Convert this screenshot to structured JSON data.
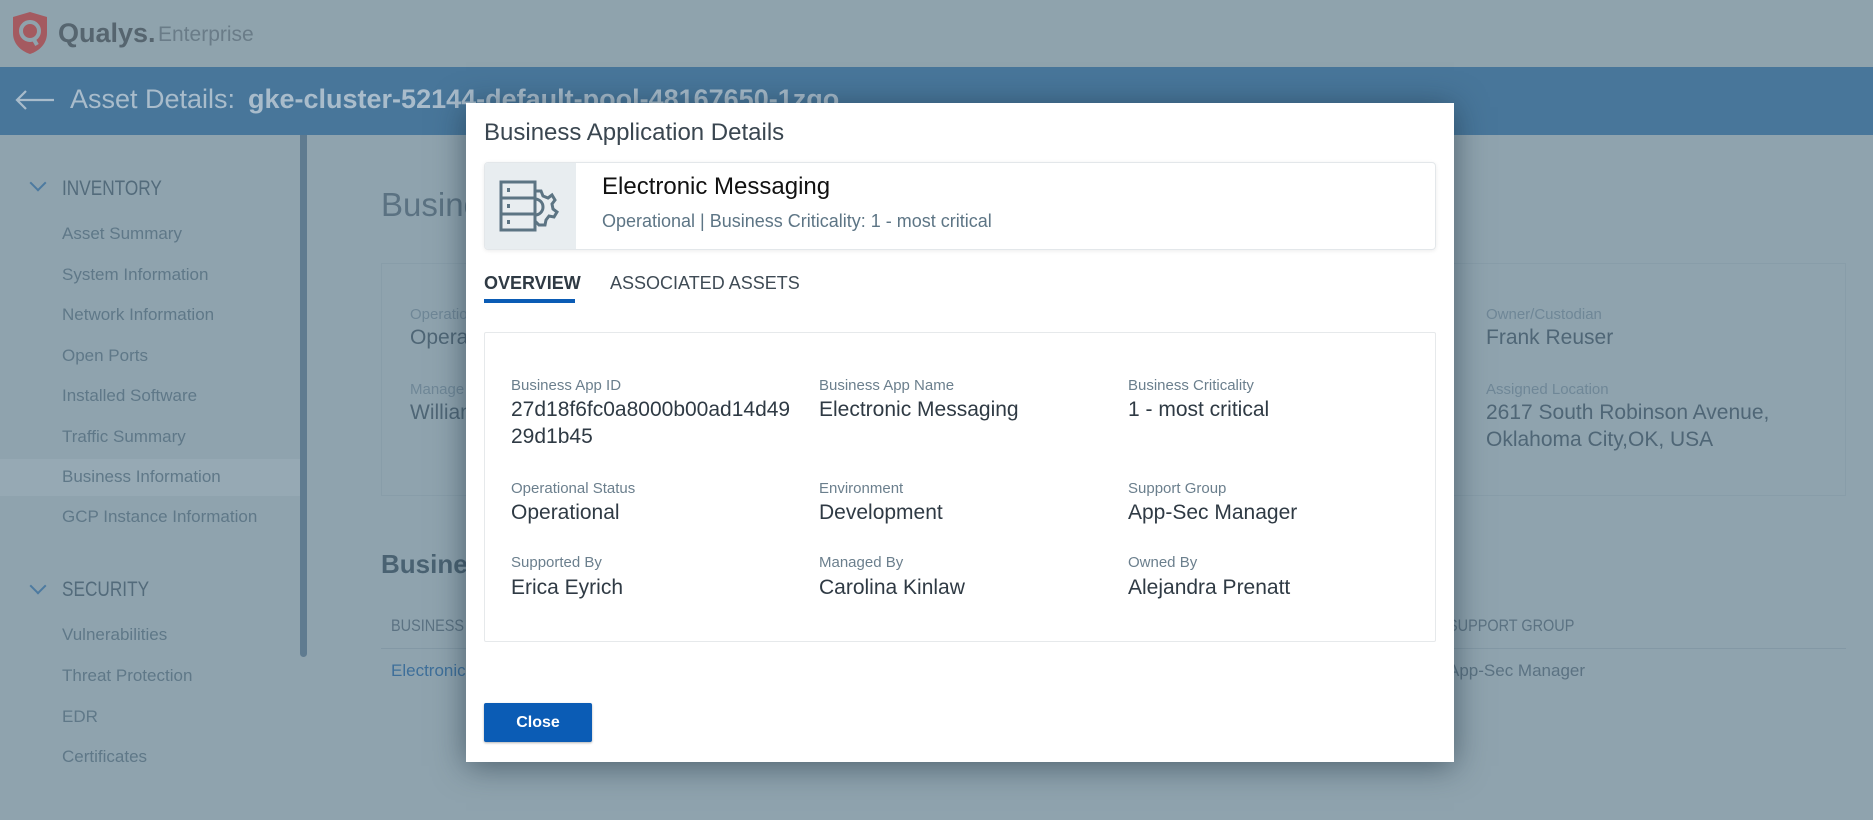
{
  "header": {
    "brand": "Qualys.",
    "product": "Enterprise"
  },
  "titlebar": {
    "label": "Asset Details:",
    "asset_name": "gke-cluster-52144-default-pool-48167650-1zgo"
  },
  "sidebar": {
    "sections": [
      {
        "title": "INVENTORY",
        "items": [
          "Asset Summary",
          "System Information",
          "Network Information",
          "Open Ports",
          "Installed Software",
          "Traffic Summary",
          "Business Information",
          "GCP Instance Information"
        ]
      },
      {
        "title": "SECURITY",
        "items": [
          "Vulnerabilities",
          "Threat Protection",
          "EDR",
          "Certificates"
        ]
      }
    ],
    "selected": "Business Information"
  },
  "background": {
    "title": "Business",
    "fields": [
      {
        "label": "Operatio",
        "value": "Opera"
      },
      {
        "label": "Manage",
        "value": "William"
      },
      {
        "label": "Owner/Custodian",
        "value": "Frank Reuser"
      },
      {
        "label": "Assigned Location",
        "value_line1": "2617 South Robinson Avenue,",
        "value_line2": "Oklahoma City,OK, USA"
      }
    ],
    "table_title": "Busine",
    "table_headers": [
      "BUSINESS A",
      "SUPPORT GROUP"
    ],
    "row": [
      "Electronic",
      "App-Sec Manager"
    ]
  },
  "modal": {
    "title": "Business Application Details",
    "app_name": "Electronic Messaging",
    "subtitle": "Operational | Business Criticality: 1 - most critical",
    "tabs": [
      {
        "label": "OVERVIEW",
        "active": true
      },
      {
        "label": "ASSOCIATED ASSETS",
        "active": false
      }
    ],
    "fields": [
      {
        "label": "Business App ID",
        "value": "27d18f6fc0a8000b00ad14d4929d1b45"
      },
      {
        "label": "Business App Name",
        "value": "Electronic Messaging"
      },
      {
        "label": "Business Criticality",
        "value": "1 - most critical"
      },
      {
        "label": "Operational Status",
        "value": "Operational"
      },
      {
        "label": "Environment",
        "value": "Development"
      },
      {
        "label": "Support Group",
        "value": "App-Sec Manager"
      },
      {
        "label": "Supported By",
        "value": "Erica Eyrich"
      },
      {
        "label": "Managed By",
        "value": "Carolina Kinlaw"
      },
      {
        "label": "Owned By",
        "value": "Alejandra Prenatt"
      }
    ],
    "close_label": "Close"
  },
  "colors": {
    "accent": "#0b5cb5",
    "titlebar": "#48769a",
    "overlay_bg": "#8fa3ae"
  }
}
